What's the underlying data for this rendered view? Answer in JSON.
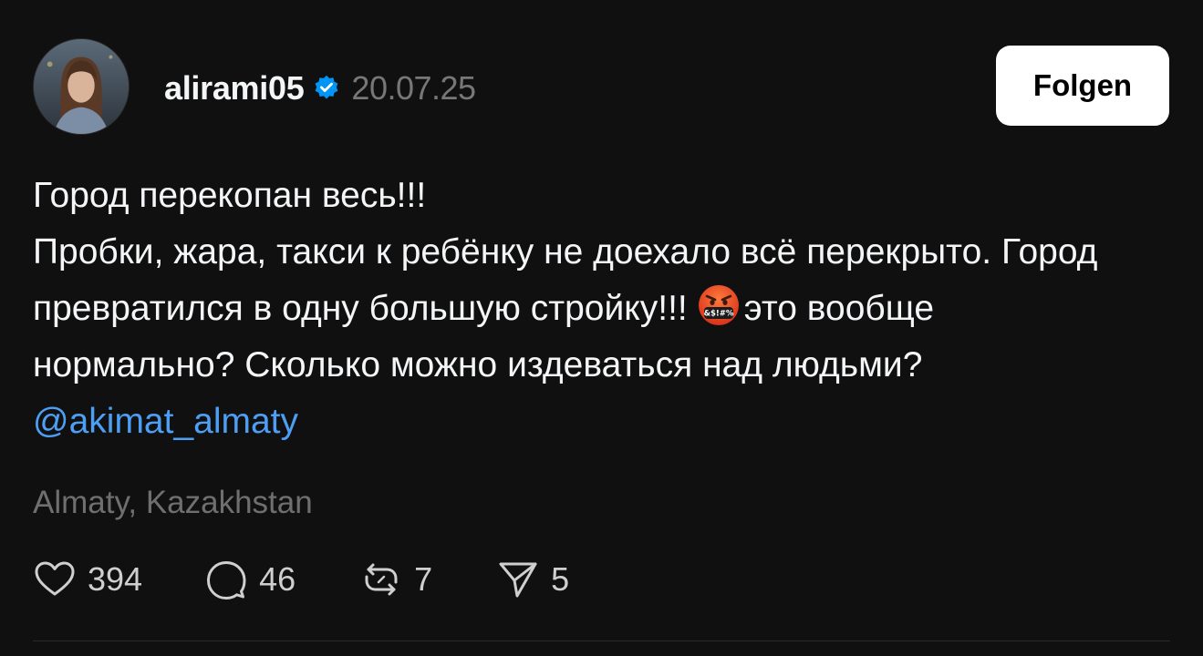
{
  "post": {
    "username": "alirami05",
    "verified": true,
    "timestamp": "20.07.25",
    "follow_label": "Folgen",
    "body_line1": "Город перекопан весь!!!",
    "body_part1": "Пробки, жара, такси к ребёнку не доехало всё перекрыто. Город превратился в одну большую стройку!!!",
    "emoji_glyph": "&$!#%",
    "body_part2": "это вообще нормально? Сколько можно издеваться над людьми?",
    "mention": "@akimat_almaty",
    "location": "Almaty, Kazakhstan",
    "stats": {
      "likes": "394",
      "replies": "46",
      "reposts": "7",
      "shares": "5"
    }
  },
  "icons": {
    "verified": "verified-badge-icon",
    "like": "heart-icon",
    "reply": "comment-bubble-icon",
    "repost": "repost-icon",
    "share": "send-icon",
    "emoji": "cursing-face-emoji"
  },
  "colors": {
    "background": "#101010",
    "mention": "#4d9ff5",
    "verified": "#0095f6",
    "button_bg": "#ffffff",
    "muted_text": "#777777"
  }
}
